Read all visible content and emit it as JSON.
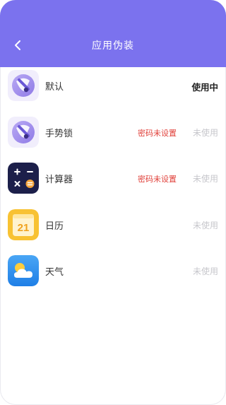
{
  "header": {
    "title": "应用伪装",
    "back_icon": "chevron-left-icon",
    "background": "#7b72ee"
  },
  "apps": [
    {
      "name": "默认",
      "warning": "",
      "status": "使用中",
      "active": true,
      "icon": "mask-app-icon"
    },
    {
      "name": "手势锁",
      "warning": "密码未设置",
      "status": "未使用",
      "active": false,
      "icon": "mask-app-icon"
    },
    {
      "name": "计算器",
      "warning": "密码未设置",
      "status": "未使用",
      "active": false,
      "icon": "calculator-icon"
    },
    {
      "name": "日历",
      "warning": "",
      "status": "未使用",
      "active": false,
      "icon": "calendar-icon",
      "icon_text": "21"
    },
    {
      "name": "天气",
      "warning": "",
      "status": "未使用",
      "active": false,
      "icon": "weather-icon"
    }
  ],
  "colors": {
    "warning": "#e0403a",
    "inactive": "#c7c7cc",
    "active": "#222222"
  }
}
